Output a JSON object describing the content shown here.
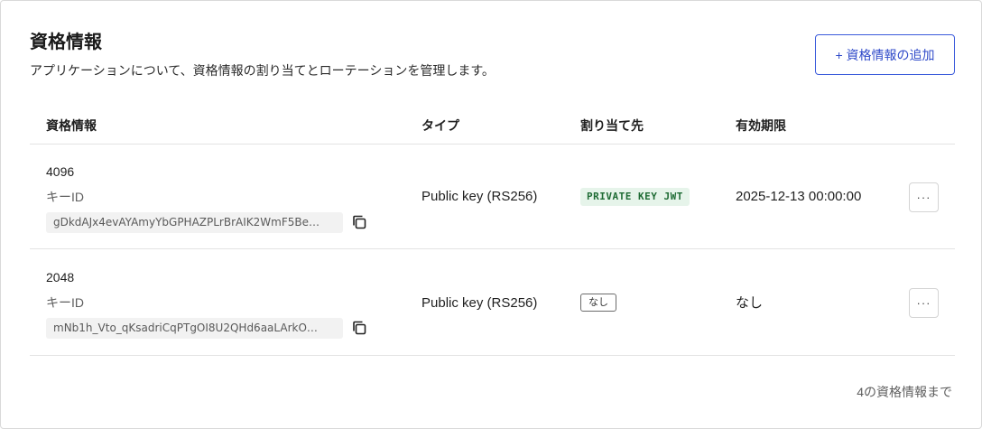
{
  "header": {
    "title": "資格情報",
    "subtitle": "アプリケーションについて、資格情報の割り当てとローテーションを管理します。",
    "add_button": "+ 資格情報の追加"
  },
  "table": {
    "columns": [
      "資格情報",
      "タイプ",
      "割り当て先",
      "有効期限"
    ],
    "rows": [
      {
        "name": "4096",
        "key_id_label": "キーID",
        "key_id": "gDkdAJx4evAYAmyYbGPHAZPLrBrAIK2WmF5Be…",
        "type": "Public key (RS256)",
        "assigned": "PRIVATE KEY JWT",
        "expiry": "2025-12-13 00:00:00",
        "more": "···"
      },
      {
        "name": "2048",
        "key_id_label": "キーID",
        "key_id": "mNb1h_Vto_qKsadriCqPTgOI8U2QHd6aaLArkO…",
        "type": "Public key (RS256)",
        "assigned": "なし",
        "expiry": "なし",
        "more": "···"
      }
    ]
  },
  "footer": {
    "limit_text": "4の資格情報まで"
  },
  "colors": {
    "accent": "#2f4ac9",
    "badge_green_bg": "#e6f4ea",
    "badge_green_text": "#1e6b34"
  },
  "icons": {
    "copy": "copy-icon",
    "more": "more-horizontal-icon"
  }
}
